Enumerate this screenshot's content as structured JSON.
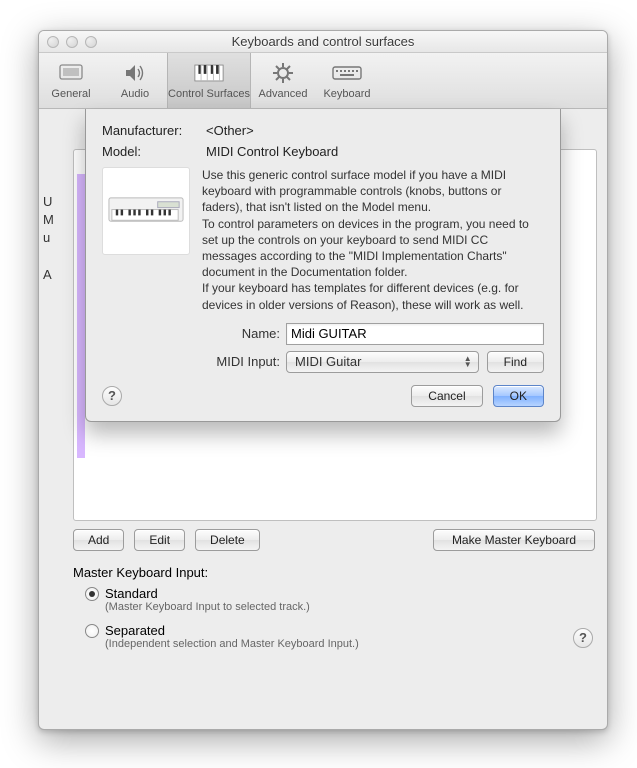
{
  "window": {
    "title": "Keyboards and control surfaces"
  },
  "toolbar": {
    "items": [
      {
        "label": "General"
      },
      {
        "label": "Audio"
      },
      {
        "label": "Control Surfaces"
      },
      {
        "label": "Advanced"
      },
      {
        "label": "Keyboard"
      }
    ]
  },
  "background": {
    "trunc1": "U",
    "trunc2": "M",
    "trunc3": "u",
    "trunc4": "A",
    "buttons": {
      "add": "Add",
      "edit": "Edit",
      "delete": "Delete",
      "master": "Make Master Keyboard"
    },
    "master_label": "Master Keyboard Input:",
    "radio_standard": "Standard",
    "radio_standard_sub": "(Master Keyboard Input to selected track.)",
    "radio_separated": "Separated",
    "radio_separated_sub": "(Independent selection and Master Keyboard Input.)"
  },
  "sheet": {
    "manufacturer_label": "Manufacturer:",
    "manufacturer_value": "<Other>",
    "model_label": "Model:",
    "model_value": "MIDI Control Keyboard",
    "desc_p1": "Use this generic control surface model if you have a MIDI keyboard with programmable controls (knobs, buttons or faders), that isn't listed on the Model menu.",
    "desc_p2": "To control parameters on devices in the program, you need to set up the controls on your keyboard to send MIDI CC messages according to the \"MIDI Implementation Charts\" document in the Documentation folder.",
    "desc_p3": "If your keyboard has templates for different devices (e.g. for devices in older versions of Reason), these will work as well.",
    "name_label": "Name:",
    "name_value": "Midi GUITAR",
    "midi_input_label": "MIDI Input:",
    "midi_input_value": "MIDI Guitar",
    "find": "Find",
    "cancel": "Cancel",
    "ok": "OK"
  }
}
